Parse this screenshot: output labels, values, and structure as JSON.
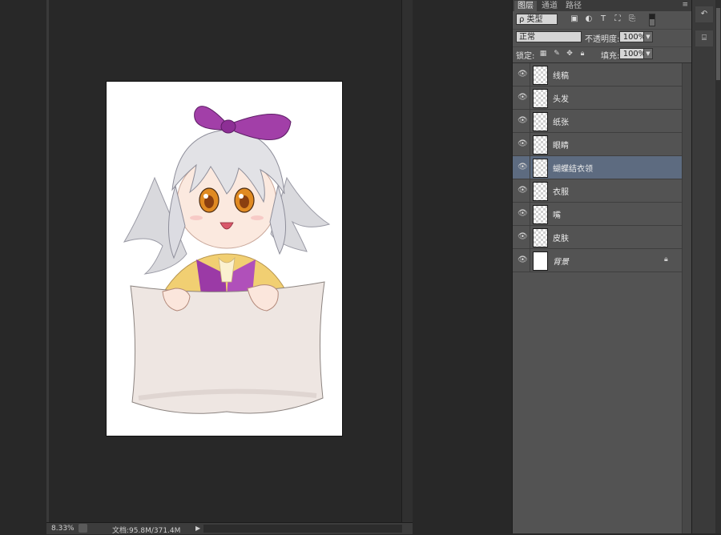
{
  "status": {
    "zoom": "8.33%",
    "doc_size": "文档:95.8M/371.4M",
    "arrow": "▶"
  },
  "panel": {
    "tabs": [
      {
        "label": "图层",
        "active": true
      },
      {
        "label": "通道",
        "active": false
      },
      {
        "label": "路径",
        "active": false
      }
    ],
    "menu_icon": "≡",
    "filter": {
      "kind": "ρ 类型",
      "icons": [
        "image-filter-icon",
        "adjustment-filter-icon",
        "type-filter-icon",
        "shape-filter-icon",
        "smart-object-filter-icon"
      ]
    },
    "blend_mode": "正常",
    "opacity_label": "不透明度:",
    "opacity_value": "100%",
    "lock_label": "锁定:",
    "fill_label": "填充:",
    "fill_value": "100%"
  },
  "layers": [
    {
      "name": "线稿",
      "selected": false,
      "locked": false,
      "thumb": "transparent"
    },
    {
      "name": "头发",
      "selected": false,
      "locked": false,
      "thumb": "transparent"
    },
    {
      "name": "纸张",
      "selected": false,
      "locked": false,
      "thumb": "transparent"
    },
    {
      "name": "眼睛",
      "selected": false,
      "locked": false,
      "thumb": "transparent"
    },
    {
      "name": "蝴蝶结衣领",
      "selected": true,
      "locked": false,
      "thumb": "transparent"
    },
    {
      "name": "衣服",
      "selected": false,
      "locked": false,
      "thumb": "transparent"
    },
    {
      "name": "嘴",
      "selected": false,
      "locked": false,
      "thumb": "transparent"
    },
    {
      "name": "皮肤",
      "selected": false,
      "locked": false,
      "thumb": "transparent"
    },
    {
      "name": "背景",
      "selected": false,
      "locked": true,
      "thumb": "white"
    }
  ],
  "colors": {
    "selected_row": "#5d6b80",
    "panel_bg": "#535353",
    "workspace": "#282828"
  }
}
